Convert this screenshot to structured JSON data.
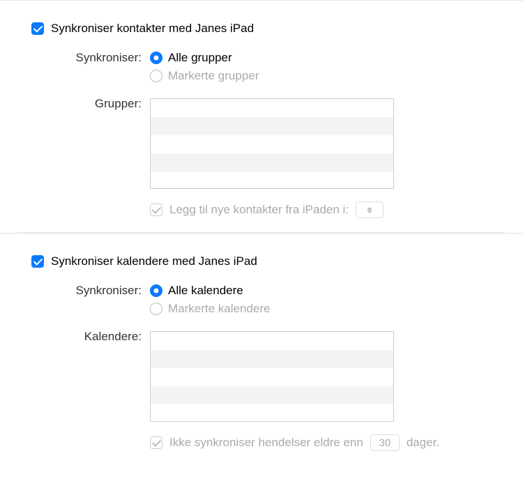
{
  "contacts": {
    "title": "Synkroniser kontakter med Janes iPad",
    "sync_label": "Synkroniser:",
    "all_option": "Alle grupper",
    "selected_option": "Markerte grupper",
    "groups_label": "Grupper:",
    "add_new_label": "Legg til nye kontakter fra iPaden i:"
  },
  "calendars": {
    "title": "Synkroniser kalendere med Janes iPad",
    "sync_label": "Synkroniser:",
    "all_option": "Alle kalendere",
    "selected_option": "Markerte kalendere",
    "calendars_label": "Kalendere:",
    "dont_sync_label": "Ikke synkroniser hendelser eldre enn",
    "days_value": "30",
    "days_suffix": "dager."
  }
}
